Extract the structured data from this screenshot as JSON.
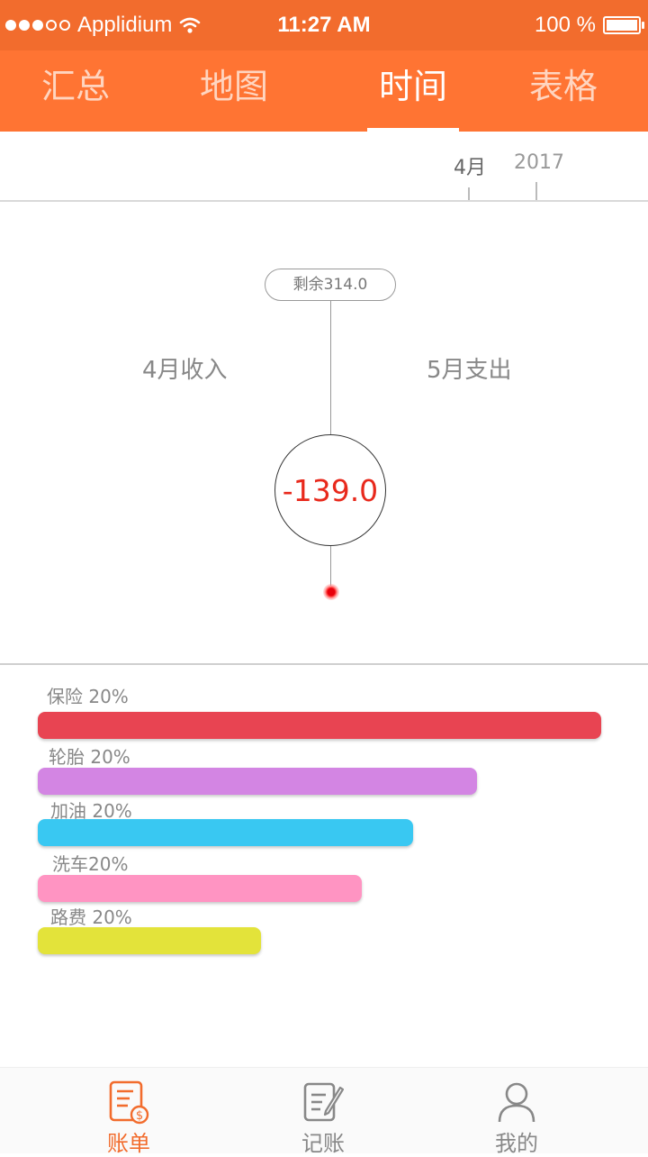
{
  "status_bar": {
    "carrier": "Applidium",
    "time": "11:27 AM",
    "battery": "100 %"
  },
  "tabs": [
    {
      "label": "汇总",
      "active": false
    },
    {
      "label": "地图",
      "active": false
    },
    {
      "label": "时间",
      "active": true
    },
    {
      "label": "表格",
      "active": false
    }
  ],
  "timeline": {
    "month": "4月",
    "year": "2017"
  },
  "summary": {
    "remaining": "剩余314.0",
    "income_label": "4月收入",
    "expense_label": "5月支出",
    "balance": "-139.0"
  },
  "categories": [
    {
      "label": "保险  20%",
      "share": 1.0,
      "color": "#e84452"
    },
    {
      "label": "轮胎  20%",
      "share": 0.78,
      "color": "#d385e3"
    },
    {
      "label": "加油 20%",
      "share": 0.67,
      "color": "#39c8f2"
    },
    {
      "label": "洗车20%",
      "share": 0.58,
      "color": "#ff94c2"
    },
    {
      "label": "路费  20%",
      "share": 0.4,
      "color": "#e3e33a"
    }
  ],
  "bottom_nav": [
    {
      "label": "账单",
      "icon": "bill-icon",
      "active": true
    },
    {
      "label": "记账",
      "icon": "write-icon",
      "active": false
    },
    {
      "label": "我的",
      "icon": "person-icon",
      "active": false
    }
  ],
  "colors": {
    "accent": "#ff7433",
    "status_bar": "#f26c2d",
    "negative": "#e8291c"
  }
}
